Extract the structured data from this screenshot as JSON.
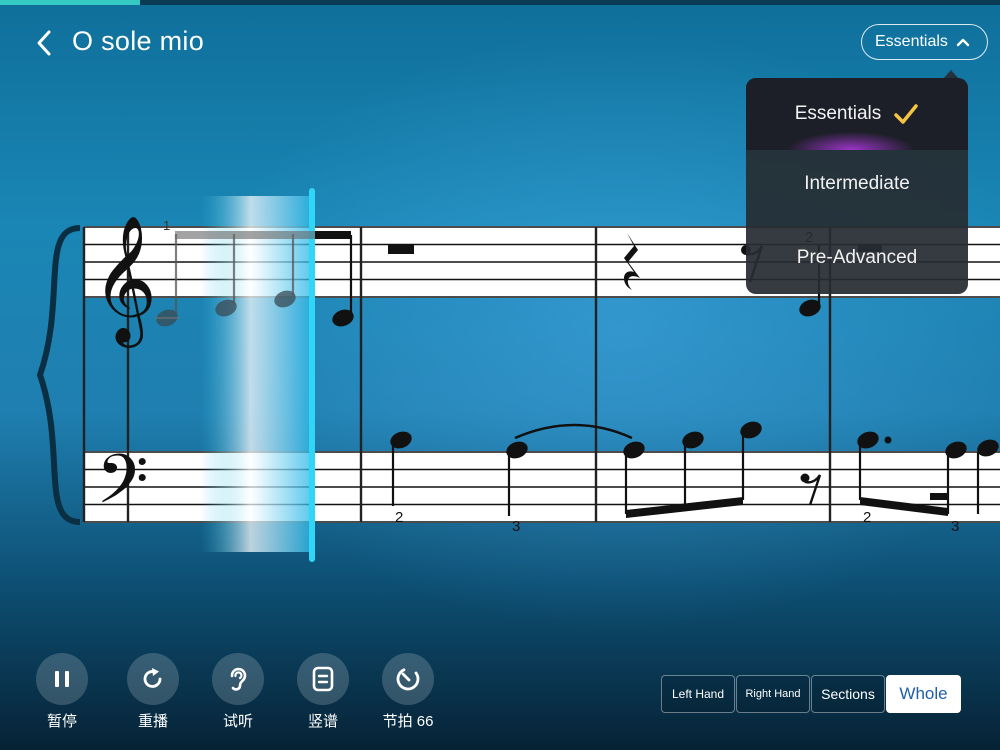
{
  "app": {
    "title": "O sole mio",
    "playback_progress": 0.14
  },
  "level_selector": {
    "current": "Essentials",
    "options": [
      "Essentials",
      "Intermediate",
      "Pre-Advanced"
    ],
    "selected_index": 0
  },
  "score": {
    "measure_number": "1",
    "fingerings": [
      "2",
      "2",
      "3",
      "2",
      "3"
    ]
  },
  "controls": [
    {
      "label": "暂停",
      "icon": "pause-icon"
    },
    {
      "label": "重播",
      "icon": "replay-icon"
    },
    {
      "label": "试听",
      "icon": "ear-icon"
    },
    {
      "label": "竖谱",
      "icon": "vertical-score-icon"
    },
    {
      "label": "节拍 66",
      "icon": "metronome-icon"
    }
  ],
  "modes": [
    {
      "label": "Left Hand"
    },
    {
      "label": "Right Hand"
    },
    {
      "label": "Sections"
    },
    {
      "label": "Whole",
      "active": true
    }
  ],
  "colors": {
    "accent": "#35c9c4",
    "checkmark": "#f5c542",
    "active_mode_text": "#1f5fa8"
  }
}
